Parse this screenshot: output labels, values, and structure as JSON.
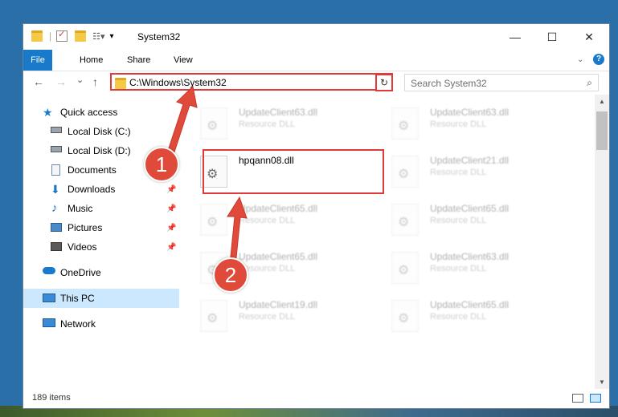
{
  "window": {
    "title": "System32",
    "controls": {
      "minimize": "—",
      "maximize": "☐",
      "close": "✕"
    }
  },
  "ribbon": {
    "tabs": [
      "File",
      "Home",
      "Share",
      "View"
    ],
    "help": "?"
  },
  "navigation": {
    "back": "←",
    "forward": "→",
    "recent": "⌄",
    "up": "↑",
    "address": "C:\\Windows\\System32",
    "search_placeholder": "Search System32"
  },
  "sidebar": {
    "items": [
      {
        "label": "Quick access",
        "icon": "star-icon",
        "pinned": false
      },
      {
        "label": "Local Disk (C:)",
        "icon": "drive-icon",
        "pinned": false
      },
      {
        "label": "Local Disk (D:)",
        "icon": "drive-icon",
        "pinned": false
      },
      {
        "label": "Documents",
        "icon": "documents-icon",
        "pinned": true
      },
      {
        "label": "Downloads",
        "icon": "download-icon",
        "pinned": true
      },
      {
        "label": "Music",
        "icon": "music-icon",
        "pinned": true
      },
      {
        "label": "Pictures",
        "icon": "pictures-icon",
        "pinned": true
      },
      {
        "label": "Videos",
        "icon": "videos-icon",
        "pinned": true
      },
      {
        "label": "OneDrive",
        "icon": "cloud-icon",
        "pinned": false
      },
      {
        "label": "This PC",
        "icon": "computer-icon",
        "pinned": false
      },
      {
        "label": "Network",
        "icon": "network-icon",
        "pinned": false
      }
    ]
  },
  "files": [
    {
      "name": "UpdateClient63.dll",
      "type": "Resource DLL",
      "faded": true
    },
    {
      "name": "UpdateClient63.dll",
      "type": "Resource DLL",
      "faded": true
    },
    {
      "name": "hpqann08.dll",
      "type": "",
      "faded": false
    },
    {
      "name": "UpdateClient21.dll",
      "type": "Resource DLL",
      "faded": true
    },
    {
      "name": "UpdateClient65.dll",
      "type": "Resource DLL",
      "faded": true
    },
    {
      "name": "UpdateClient65.dll",
      "type": "Resource DLL",
      "faded": true
    },
    {
      "name": "UpdateClient65.dll",
      "type": "Resource DLL",
      "faded": true
    },
    {
      "name": "UpdateClient63.dll",
      "type": "Resource DLL",
      "faded": true
    },
    {
      "name": "UpdateClient19.dll",
      "type": "Resource DLL",
      "faded": true
    },
    {
      "name": "UpdateClient65.dll",
      "type": "Resource DLL",
      "faded": true
    }
  ],
  "status": {
    "item_count": "189 items"
  },
  "annotations": {
    "step1": "1",
    "step2": "2"
  },
  "colors": {
    "accent": "#1979ca",
    "highlight": "#e03a3a",
    "selected": "#cce8ff"
  }
}
